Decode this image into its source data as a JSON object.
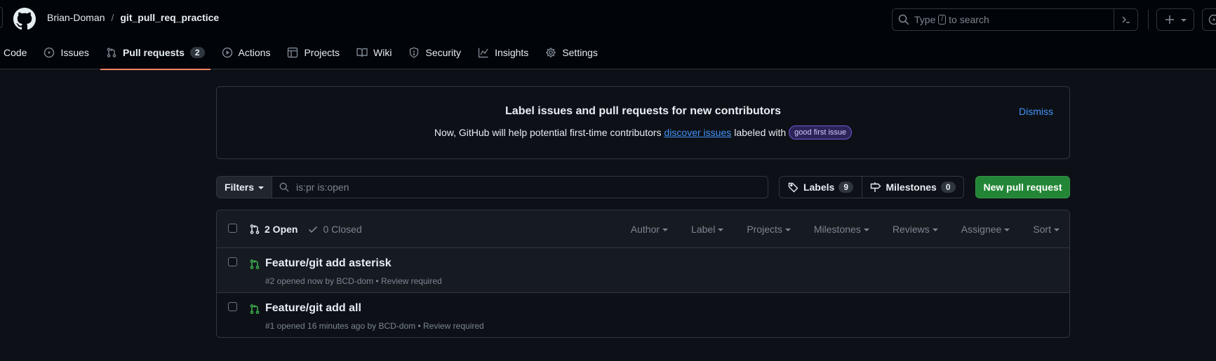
{
  "colors": {
    "accent_underline": "#f78166",
    "link": "#4493f8",
    "open_green": "#3fb950",
    "primary_button": "#238636"
  },
  "header": {
    "owner": "Brian-Doman",
    "separator": "/",
    "repo": "git_pull_req_practice",
    "search_prefix": "Type",
    "search_key": "/",
    "search_suffix": "to search",
    "plus_icon": "plus-icon"
  },
  "tabs": [
    {
      "label": "Code",
      "icon": "code-icon"
    },
    {
      "label": "Issues",
      "icon": "issue-opened-icon"
    },
    {
      "label": "Pull requests",
      "icon": "git-pull-request-icon",
      "count": "2",
      "active": true
    },
    {
      "label": "Actions",
      "icon": "play-icon"
    },
    {
      "label": "Projects",
      "icon": "table-icon"
    },
    {
      "label": "Wiki",
      "icon": "book-icon"
    },
    {
      "label": "Security",
      "icon": "shield-icon"
    },
    {
      "label": "Insights",
      "icon": "graph-icon"
    },
    {
      "label": "Settings",
      "icon": "gear-icon"
    }
  ],
  "banner": {
    "title": "Label issues and pull requests for new contributors",
    "text_before": "Now, GitHub will help potential first-time contributors",
    "link": "discover issues",
    "text_after": "labeled with",
    "badge": "good first issue",
    "dismiss": "Dismiss"
  },
  "filters": {
    "button": "Filters",
    "query": "is:pr is:open",
    "labels": "Labels",
    "labels_count": "9",
    "milestones": "Milestones",
    "milestones_count": "0",
    "new_pr": "New pull request"
  },
  "list": {
    "open": "2 Open",
    "closed": "0 Closed",
    "sorts": [
      "Author",
      "Label",
      "Projects",
      "Milestones",
      "Reviews",
      "Assignee",
      "Sort"
    ],
    "items": [
      {
        "title": "Feature/git add asterisk",
        "meta": "#2 opened now by BCD-dom • Review required"
      },
      {
        "title": "Feature/git add all",
        "meta": "#1 opened 16 minutes ago by BCD-dom • Review required"
      }
    ]
  }
}
